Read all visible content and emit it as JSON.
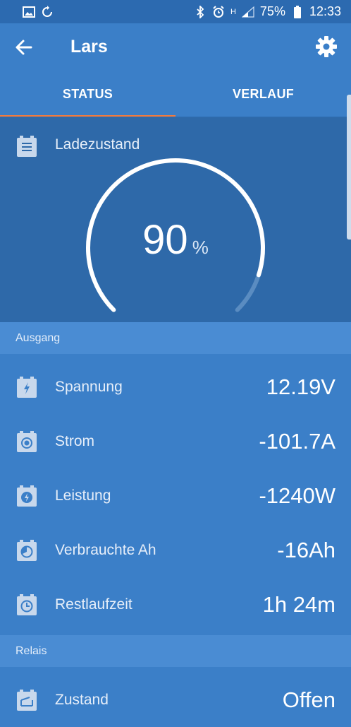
{
  "statusbar": {
    "battery_percent": "75%",
    "time": "12:33",
    "network_label": "H"
  },
  "appbar": {
    "title": "Lars"
  },
  "tabs": [
    {
      "label": "STATUS",
      "active": true
    },
    {
      "label": "VERLAUF",
      "active": false
    }
  ],
  "gauge": {
    "label": "Ladezustand",
    "value": "90",
    "unit": "%",
    "level": 0.9
  },
  "sections": {
    "output": {
      "header": "Ausgang",
      "rows": [
        {
          "icon": "lightning-icon",
          "label": "Spannung",
          "value": "12.19V"
        },
        {
          "icon": "current-icon",
          "label": "Strom",
          "value": "-101.7A"
        },
        {
          "icon": "power-icon",
          "label": "Leistung",
          "value": "-1240W"
        },
        {
          "icon": "consumed-ah-icon",
          "label": "Verbrauchte Ah",
          "value": "-16Ah"
        },
        {
          "icon": "clock-icon",
          "label": "Restlaufzeit",
          "value": "1h 24m"
        }
      ]
    },
    "relay": {
      "header": "Relais",
      "rows": [
        {
          "icon": "relay-icon",
          "label": "Zustand",
          "value": "Offen"
        }
      ]
    }
  },
  "colors": {
    "background": "#3b7fc8",
    "statusbar": "#2c6ab0",
    "gauge_bg": "#2e69a9",
    "section_header": "#4a8cd3",
    "tab_indicator": "#f47b3c"
  }
}
